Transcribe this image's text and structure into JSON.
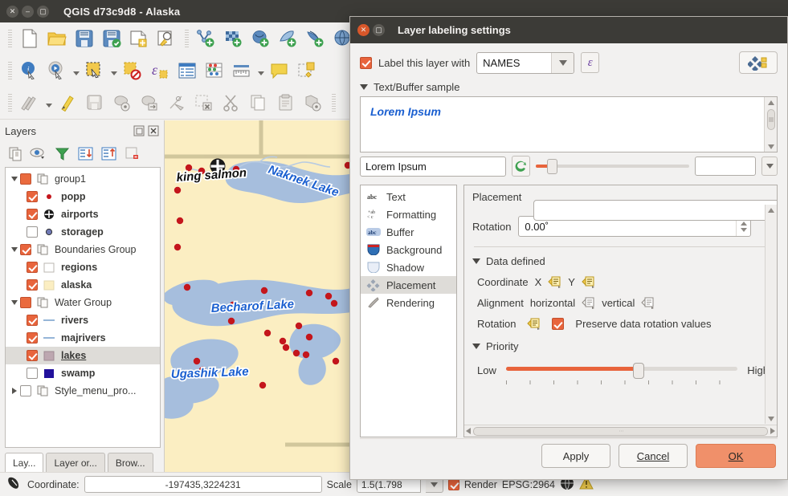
{
  "window": {
    "title": "QGIS d73c9d8 - Alaska",
    "controls": [
      "close",
      "minimize",
      "maximize"
    ]
  },
  "toolbars": {
    "row1": [
      "new-project-icon",
      "open-project-icon",
      "save-project-icon",
      "save-project-as-icon",
      "new-print-composer-icon",
      "composer-manager-icon",
      "add-vector-layer-icon",
      "add-raster-layer-icon",
      "add-postgis-layer-icon",
      "add-spatialite-layer-icon",
      "add-mssql-layer-icon",
      "add-wms-layer-icon"
    ],
    "row2": [
      "identify-features-icon",
      "run-feature-action-icon",
      "select-features-icon",
      "deselect-features-icon",
      "open-attribute-table-icon",
      "open-field-calculator-icon",
      "open-table-icon",
      "statistical-summary-icon",
      "measure-line-icon",
      "map-tips-icon",
      "new-map-view-icon"
    ],
    "row3": [
      "current-edits-icon",
      "toggle-editing-icon",
      "save-layer-edits-icon",
      "add-feature-icon",
      "move-feature-icon",
      "node-tool-icon",
      "delete-selected-icon",
      "cut-features-icon",
      "copy-features-icon",
      "paste-features-icon",
      "advanced-digitizing-icon"
    ]
  },
  "panel": {
    "title": "Layers",
    "header_icons": [
      "undock-panel-icon",
      "close-panel-icon"
    ],
    "tools": [
      "open-layer-styling-icon",
      "manage-map-themes-icon",
      "filter-legend-icon",
      "expand-all-icon",
      "collapse-all-icon",
      "remove-layer-icon"
    ],
    "tree": [
      {
        "label": "group1",
        "type": "group",
        "expanded": true,
        "checked": "partial",
        "indent": 0,
        "symbol": "group-icon"
      },
      {
        "label": "popp",
        "type": "layer",
        "checked": true,
        "indent": 1,
        "symbol": "point-red"
      },
      {
        "label": "airports",
        "type": "layer",
        "checked": true,
        "indent": 1,
        "symbol": "airport-icon"
      },
      {
        "label": "storagep",
        "type": "layer",
        "checked": false,
        "indent": 1,
        "symbol": "point-blue"
      },
      {
        "label": "Boundaries Group",
        "type": "group",
        "expanded": true,
        "checked": true,
        "indent": 0,
        "symbol": "group-icon"
      },
      {
        "label": "regions",
        "type": "layer",
        "checked": true,
        "indent": 1,
        "symbol": "fill-white"
      },
      {
        "label": "alaska",
        "type": "layer",
        "checked": true,
        "indent": 1,
        "symbol": "fill-cream"
      },
      {
        "label": "Water Group",
        "type": "group",
        "expanded": true,
        "checked": "partial",
        "indent": 0,
        "symbol": "group-icon"
      },
      {
        "label": "rivers",
        "type": "layer",
        "checked": true,
        "indent": 1,
        "symbol": "line-blue"
      },
      {
        "label": "majrivers",
        "type": "layer",
        "checked": true,
        "indent": 1,
        "symbol": "line-blue"
      },
      {
        "label": "lakes",
        "type": "layer",
        "checked": true,
        "indent": 1,
        "symbol": "fill-mauve",
        "selected": true
      },
      {
        "label": "swamp",
        "type": "layer",
        "checked": false,
        "indent": 1,
        "symbol": "fill-navy"
      },
      {
        "label": "Style_menu_pro...",
        "type": "group",
        "expanded": false,
        "checked": false,
        "indent": 0,
        "symbol": "group-icon"
      }
    ],
    "tabs": [
      {
        "label": "Lay...",
        "active": true
      },
      {
        "label": "Layer or...",
        "active": false
      },
      {
        "label": "Brow...",
        "active": false
      }
    ]
  },
  "map": {
    "labels": [
      {
        "text": "king salmon",
        "style": "place"
      },
      {
        "text": "Naknek Lake",
        "style": "water"
      },
      {
        "text": "Becharof Lake",
        "style": "water"
      },
      {
        "text": "Ugashik Lake",
        "style": "water"
      }
    ],
    "colors": {
      "land": "#fbeec2",
      "water": "#a6bedd",
      "point": "#c4161c",
      "border": "#cfc49a"
    }
  },
  "status": {
    "coordinate_label": "Coordinate:",
    "coordinate_value": "-197435,3224231",
    "scale_label": "Scale",
    "scale_value": "1.5(1.798",
    "render_label": "Render",
    "crs_label": "EPSG:2964"
  },
  "dialog": {
    "title": "Layer labeling settings",
    "label_layer_checkbox": "Label this layer with",
    "field_value": "NAMES",
    "expression_button": "ε",
    "auto_placement_button": "automated-placement-icon",
    "sample_section": "Text/Buffer sample",
    "sample_preview_text": "Lorem Ipsum",
    "sample_input_value": "Lorem Ipsum",
    "tabs": [
      {
        "label": "Text",
        "icon": "text-icon",
        "selected": false
      },
      {
        "label": "Formatting",
        "icon": "formatting-icon",
        "selected": false
      },
      {
        "label": "Buffer",
        "icon": "buffer-icon",
        "selected": false
      },
      {
        "label": "Background",
        "icon": "background-icon",
        "selected": false
      },
      {
        "label": "Shadow",
        "icon": "shadow-icon",
        "selected": false
      },
      {
        "label": "Placement",
        "icon": "placement-icon",
        "selected": true
      },
      {
        "label": "Rendering",
        "icon": "rendering-icon",
        "selected": false
      }
    ],
    "placement": {
      "heading": "Placement",
      "rotation_label": "Rotation",
      "rotation_value": "0.00˚",
      "data_defined_heading": "Data defined",
      "coordinate_label": "Coordinate",
      "coordinate_x": "X",
      "coordinate_y": "Y",
      "alignment_label": "Alignment",
      "alignment_horizontal": "horizontal",
      "alignment_vertical": "vertical",
      "rotation_dd_label": "Rotation",
      "preserve_rotation_label": "Preserve data rotation values",
      "preserve_rotation_checked": true,
      "priority_heading": "Priority",
      "priority_low": "Low",
      "priority_high": "High",
      "priority_percent": 55
    },
    "buttons": {
      "apply": "Apply",
      "cancel": "Cancel",
      "ok": "OK"
    }
  },
  "colors": {
    "accent_orange": "#e8643c",
    "ok_button": "#f0906a",
    "titlebar": "#3c3b37",
    "label_blue": "#1a5fd0"
  }
}
